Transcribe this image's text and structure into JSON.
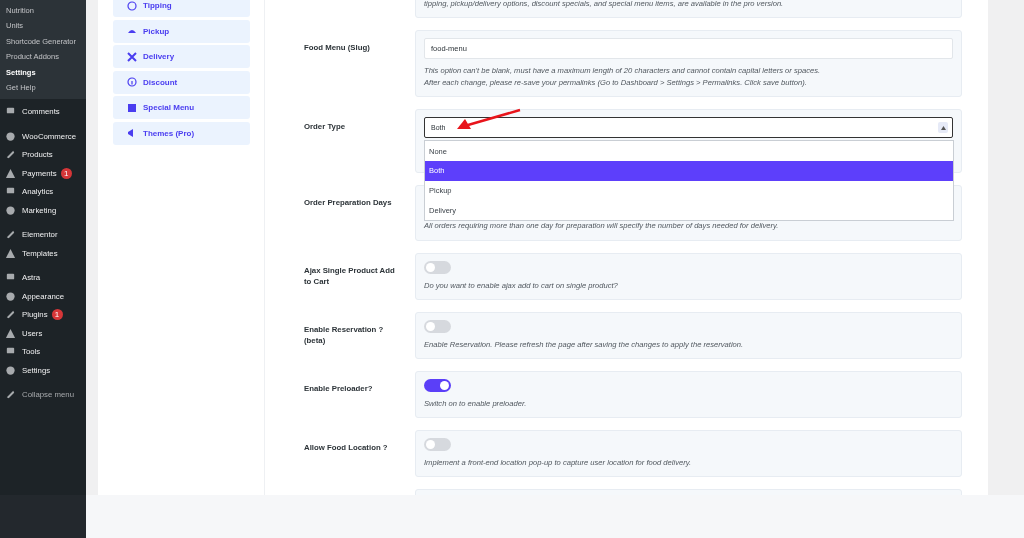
{
  "admin_menu": {
    "submenu": [
      {
        "label": "Nutrition",
        "selected": false
      },
      {
        "label": "Units",
        "selected": false
      },
      {
        "label": "Shortcode Generator",
        "selected": false
      },
      {
        "label": "Product Addons",
        "selected": false
      },
      {
        "label": "Settings",
        "selected": true
      },
      {
        "label": "Get Help",
        "selected": false
      }
    ],
    "groups": [
      [
        {
          "label": "Comments"
        }
      ],
      [
        {
          "label": "WooCommerce"
        },
        {
          "label": "Products"
        },
        {
          "label": "Payments",
          "badge": "1"
        },
        {
          "label": "Analytics"
        },
        {
          "label": "Marketing"
        }
      ],
      [
        {
          "label": "Elementor"
        },
        {
          "label": "Templates"
        }
      ],
      [
        {
          "label": "Astra"
        },
        {
          "label": "Appearance"
        },
        {
          "label": "Plugins",
          "badge": "1"
        },
        {
          "label": "Users"
        },
        {
          "label": "Tools"
        },
        {
          "label": "Settings"
        }
      ],
      [
        {
          "label": "Collapse menu"
        }
      ]
    ]
  },
  "tabs": [
    {
      "label": "Tipping"
    },
    {
      "label": "Pickup"
    },
    {
      "label": "Delivery"
    },
    {
      "label": "Discount"
    },
    {
      "label": "Special Menu"
    },
    {
      "label": "Themes (Pro)"
    }
  ],
  "settings": [
    {
      "kind": "note",
      "description": "tipping, pickup/delivery options, discount specials, and special menu items, are available in the pro version."
    },
    {
      "kind": "text",
      "label": "Food Menu (Slug)",
      "value": "food-menu",
      "description": "This option can't be blank, must have a maximum length of 20 characters and cannot contain capital letters or spaces.\nAfter each change, please re-save your permalinks (Go to Dashboard > Settings > Permalinks. Click save button)."
    },
    {
      "kind": "select",
      "label": "Order Type",
      "value": "Both",
      "expanded": true,
      "options": [
        {
          "label": "None",
          "selected": false
        },
        {
          "label": "Both",
          "selected": true
        },
        {
          "label": "Pickup",
          "selected": false
        },
        {
          "label": "Delivery",
          "selected": false
        }
      ]
    },
    {
      "kind": "hidden",
      "label": "Order Preparation Days",
      "description": "All orders requiring more than one day for preparation will specify the number of days needed for delivery."
    },
    {
      "kind": "toggle",
      "label": "Ajax Single Product Add to Cart",
      "on": false,
      "description": "Do you want to enable ajax add to cart on single product?"
    },
    {
      "kind": "toggle",
      "label": "Enable Reservation ? (beta)",
      "on": false,
      "description": "Enable Reservation. Please refresh the page after saving the changes to apply the reservation."
    },
    {
      "kind": "toggle",
      "label": "Enable Preloader?",
      "on": true,
      "description": "Switch on to enable preloader."
    },
    {
      "kind": "toggle",
      "label": "Allow Food Location ?",
      "on": false,
      "description": "Implement a front-end location pop-up to capture user location for food delivery."
    }
  ]
}
